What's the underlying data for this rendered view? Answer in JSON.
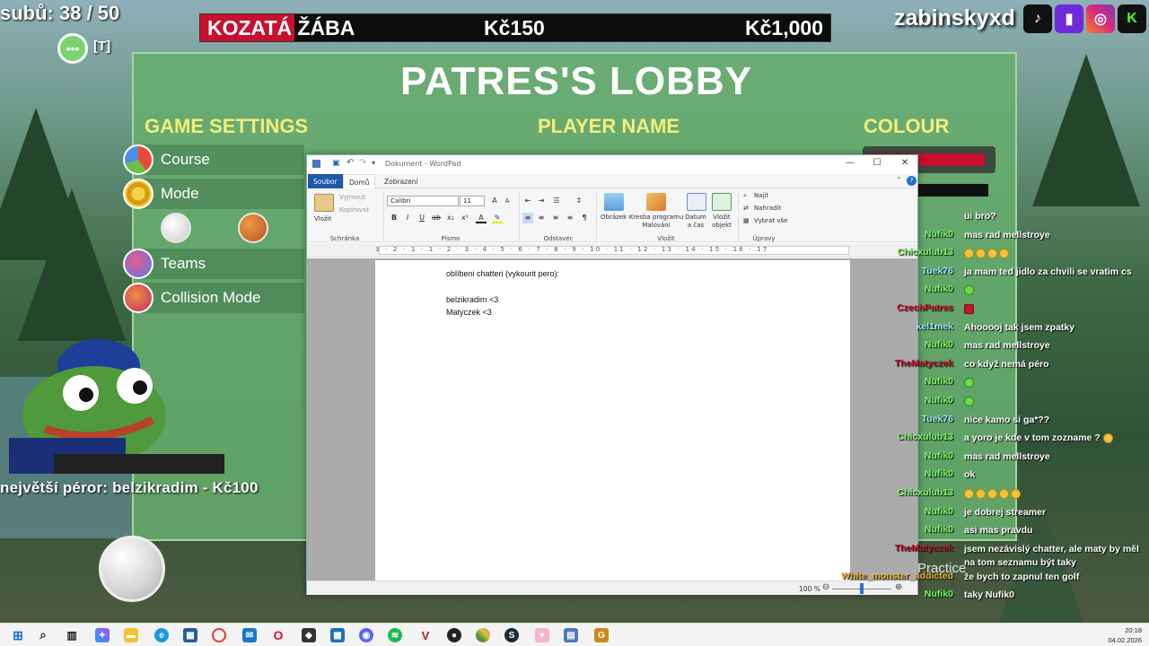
{
  "overlay": {
    "subs_label": "subů: 38 / 50",
    "chat_hint": "[T]",
    "goal": {
      "name": "KOZATÁ ŽÁBA",
      "current": "Kč150",
      "target": "Kč1,000",
      "progress": 0.15
    },
    "handle": "zabinskyxd",
    "top_sub": "největší péror: belzikradim - Kč100",
    "practice_label": "Practice"
  },
  "lobby": {
    "title": "PATRES'S LOBBY",
    "headers": {
      "settings": "GAME SETTINGS",
      "player": "PLAYER NAME",
      "colour": "COLOUR"
    },
    "settings": [
      {
        "label": "Course"
      },
      {
        "label": "Mode"
      },
      {
        "label": "Teams"
      },
      {
        "label": "Collision Mode"
      }
    ]
  },
  "wordpad": {
    "title": "Dokument - WordPad",
    "tabs": [
      "Soubor",
      "Domů",
      "Zobrazení"
    ],
    "ribbon": {
      "paste": "Vložit",
      "cut": "Vyjmout",
      "copy": "Kopírovat",
      "clipboard_group": "Schránka",
      "font_name": "Calibri",
      "font_size": "11",
      "font_group": "Písmo",
      "paragraph_group": "Odstavec",
      "picture": "Obrázek",
      "paint": "Kresba programu Malování",
      "datetime": "Datum a čas",
      "object": "Vložit objekt",
      "insert_group": "Vložit",
      "find": "Najít",
      "replace": "Nahradit",
      "select_all": "Vybrat vše",
      "edit_group": "Úpravy"
    },
    "ruler": "3 · 2 · 1 · 1 · 2 · 3 · 4 · 5 · 6 · 7 · 8 · 9 · 10 · 11 · 12 · 13 · 14 · 15 · 16 · 17",
    "doc_lines": [
      "oblíbeni chatteri (vykourit pero):",
      "",
      "belzikradim <3",
      "Matyczek <3"
    ],
    "zoom": "100 %"
  },
  "chat": [
    {
      "user": "",
      "text": "ui bro?",
      "color": "#ffffff"
    },
    {
      "user": "Nufik0",
      "text": "mas rad mellstroye",
      "color": "#7cfc6a"
    },
    {
      "user": "Chicxulub13",
      "text": "",
      "emojis": 4,
      "color": "#7cfc6a"
    },
    {
      "user": "Tuek76",
      "text": "ja mam ted jidlo za chvili se vratim cs",
      "color": "#9be7ff"
    },
    {
      "user": "Nufik0",
      "text": "",
      "emojis_green": 1,
      "color": "#7cfc6a"
    },
    {
      "user": "CzechPatres",
      "text": "",
      "emojis_red": 1,
      "color": "#d81b30"
    },
    {
      "user": "kel1mek",
      "text": "Ahooooj tak jsem zpatky",
      "color": "#9be7ff"
    },
    {
      "user": "Nufik0",
      "text": "mas rad mellstroye",
      "color": "#7cfc6a"
    },
    {
      "user": "TheMatyczek",
      "text": "co když nemá péro",
      "color": "#c0182b"
    },
    {
      "user": "Nufik0",
      "text": "",
      "emojis_green": 1,
      "color": "#7cfc6a"
    },
    {
      "user": "Nufik0",
      "text": "",
      "emojis_green": 1,
      "color": "#7cfc6a"
    },
    {
      "user": "Tuek76",
      "text": "nice kamo si ga*??",
      "color": "#9be7ff"
    },
    {
      "user": "Chicxulub13",
      "text": "a yoro je kde v tom zozname ?",
      "emojis_after": 1,
      "color": "#7cfc6a"
    },
    {
      "user": "Nufik0",
      "text": "mas rad mellstroye",
      "color": "#7cfc6a"
    },
    {
      "user": "Nufik0",
      "text": "ok",
      "color": "#7cfc6a"
    },
    {
      "user": "Chicxulub13",
      "text": "",
      "emojis": 5,
      "color": "#7cfc6a"
    },
    {
      "user": "Nufik0",
      "text": "je dobrej streamer",
      "color": "#7cfc6a"
    },
    {
      "user": "Nufik0",
      "text": "asi mas pravdu",
      "color": "#7cfc6a"
    },
    {
      "user": "TheMatyczek",
      "text": "jsem nezávislý chatter, ale maty by měl na tom seznamu být taky",
      "color": "#c0182b"
    },
    {
      "user": "White_monster_addicted",
      "text": "že bych to zapnul ten golf",
      "color": "#f0b23a"
    },
    {
      "user": "Nufik0",
      "text": "taky Nufik0",
      "color": "#7cfc6a"
    }
  ],
  "taskbar": {
    "time": "20:18",
    "date": "04.02.2026"
  }
}
